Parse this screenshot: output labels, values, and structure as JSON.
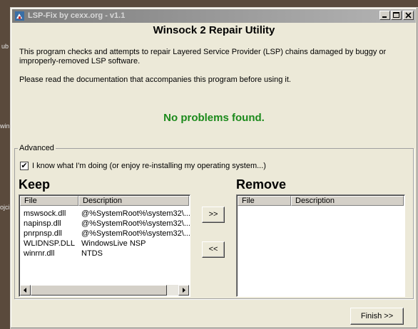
{
  "window": {
    "title": "LSP-Fix by cexx.org - v1.1"
  },
  "heading": "Winsock 2 Repair Utility",
  "intro": {
    "line1": "This program checks and attempts to repair Layered Service Provider (LSP) chains damaged by buggy or",
    "line2": "improperly-removed LSP software.",
    "line3": "Please read the documentation that accompanies this program before using it."
  },
  "status": "No problems found.",
  "advanced": {
    "label": "Advanced",
    "checkbox_label": "I know what I'm doing (or enjoy re-installing my operating system...)",
    "checked": true,
    "check_mark": "✔"
  },
  "keep": {
    "title": "Keep",
    "columns": [
      "File",
      "Description"
    ],
    "rows": [
      {
        "file": "mswsock.dll",
        "desc": "@%SystemRoot%\\system32\\..."
      },
      {
        "file": "napinsp.dll",
        "desc": "@%SystemRoot%\\system32\\..."
      },
      {
        "file": "pnrpnsp.dll",
        "desc": "@%SystemRoot%\\system32\\..."
      },
      {
        "file": "WLIDNSP.DLL",
        "desc": "WindowsLive NSP"
      },
      {
        "file": "winrnr.dll",
        "desc": "NTDS"
      }
    ]
  },
  "remove": {
    "title": "Remove",
    "columns": [
      "File",
      "Description"
    ]
  },
  "buttons": {
    "move_right": ">>",
    "move_left": "<<",
    "finish": "Finish >>"
  },
  "background": {
    "text1": "ub",
    "text2": "winr",
    "text3": "ojci"
  }
}
